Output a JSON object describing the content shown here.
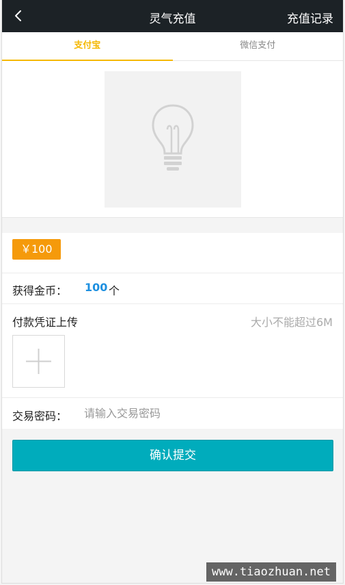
{
  "header": {
    "title": "灵气充值",
    "history_label": "充值记录",
    "back_icon": "chevron-left-icon"
  },
  "tabs": [
    {
      "label": "支付宝",
      "active": true
    },
    {
      "label": "微信支付",
      "active": false
    }
  ],
  "qr": {
    "icon": "lightbulb-icon"
  },
  "form": {
    "amount_label": "￥100",
    "coins_label": "获得金币：",
    "coins_value": "100",
    "coins_unit": "个",
    "upload_label": "付款凭证上传",
    "upload_hint": "大小不能超过6M",
    "upload_icon": "plus-icon",
    "password_label": "交易密码：",
    "password_placeholder": "请输入交易密码",
    "password_value": ""
  },
  "submit_label": "确认提交",
  "watermark": "www.tiaozhuan.net",
  "colors": {
    "header_bg": "#1c2226",
    "tab_active": "#f5b800",
    "amount_badge": "#f59a0b",
    "coins_value": "#1e90e0",
    "submit": "#00acbc"
  }
}
